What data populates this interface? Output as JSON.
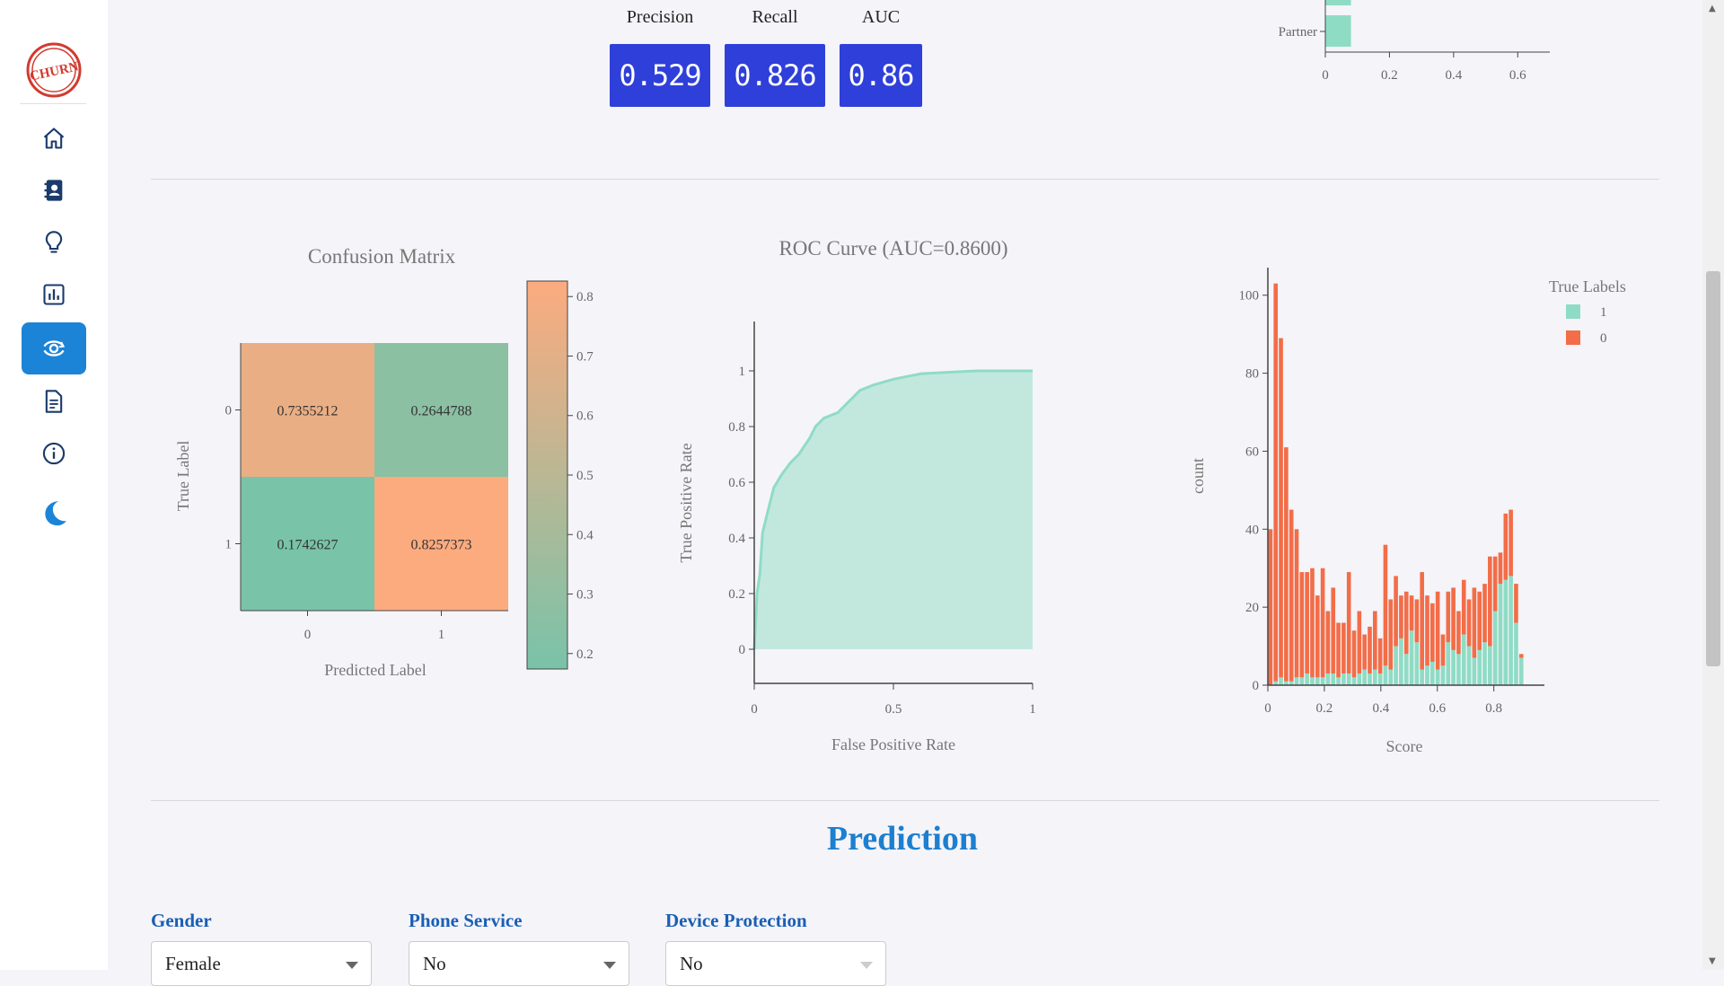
{
  "metrics": [
    {
      "label": "Precision",
      "value": "0.529"
    },
    {
      "label": "Recall",
      "value": "0.826"
    },
    {
      "label": "AUC",
      "value": "0.86"
    }
  ],
  "logo_text": "CHURN",
  "nav": [
    {
      "icon": "home-icon"
    },
    {
      "icon": "contacts-icon"
    },
    {
      "icon": "lightbulb-icon"
    },
    {
      "icon": "bar-chart-icon"
    },
    {
      "icon": "model-icon",
      "active": true
    },
    {
      "icon": "document-icon"
    },
    {
      "icon": "info-icon"
    },
    {
      "icon": "moon-icon"
    }
  ],
  "colors": {
    "accent": "#1c84d7",
    "metric_box": "#2f3fd9",
    "mint": "#8fdcc4",
    "orange": "#f26d48",
    "peach": "#fcab7f",
    "teal": "#79c3a9"
  },
  "chart_data": [
    {
      "type": "bar",
      "orientation": "horizontal",
      "categories": [
        "Partner"
      ],
      "values": [
        0.08
      ],
      "xticks": [
        "0",
        "0.2",
        "0.4",
        "0.6"
      ],
      "xlim": [
        0,
        0.7
      ]
    },
    {
      "type": "heatmap",
      "title": "Confusion Matrix",
      "xlabel": "Predicted Label",
      "ylabel": "True Label",
      "x_categories": [
        "0",
        "1"
      ],
      "y_categories": [
        "0",
        "1"
      ],
      "z": [
        [
          0.7355212,
          0.2644788
        ],
        [
          0.1742627,
          0.8257373
        ]
      ],
      "z_labels": [
        [
          "0.7355212",
          "0.2644788"
        ],
        [
          "0.1742627",
          "0.8257373"
        ]
      ],
      "colorscale": [
        "#79c3a9",
        "#fcab7f"
      ],
      "colorbar_ticks": [
        "0.8",
        "0.7",
        "0.6",
        "0.5",
        "0.4",
        "0.3",
        "0.2"
      ],
      "zlim": [
        0.174,
        0.826
      ]
    },
    {
      "type": "area",
      "title": "ROC Curve (AUC=0.8600)",
      "xlabel": "False Positive Rate",
      "ylabel": "True Positive Rate",
      "xlim": [
        0,
        1
      ],
      "ylim": [
        0,
        1
      ],
      "xticks": [
        "0",
        "0.5",
        "1"
      ],
      "yticks": [
        "0",
        "0.2",
        "0.4",
        "0.6",
        "0.8",
        "1"
      ],
      "x": [
        0,
        0.005,
        0.01,
        0.02,
        0.03,
        0.05,
        0.07,
        0.1,
        0.13,
        0.16,
        0.2,
        0.22,
        0.25,
        0.3,
        0.33,
        0.38,
        0.43,
        0.5,
        0.6,
        0.7,
        0.8,
        1.0
      ],
      "y": [
        0,
        0.1,
        0.2,
        0.27,
        0.42,
        0.5,
        0.58,
        0.63,
        0.67,
        0.7,
        0.76,
        0.8,
        0.83,
        0.85,
        0.88,
        0.93,
        0.95,
        0.97,
        0.99,
        0.995,
        1.0,
        1.0
      ]
    },
    {
      "type": "bar",
      "mode": "stacked",
      "xlabel": "Score",
      "ylabel": "count",
      "xlim": [
        0,
        0.96
      ],
      "ylim": [
        0,
        108
      ],
      "xticks": [
        "0",
        "0.2",
        "0.4",
        "0.6",
        "0.8"
      ],
      "yticks": [
        "0",
        "20",
        "40",
        "60",
        "80",
        "100"
      ],
      "legend_title": "True Labels",
      "legend_position": "top-right",
      "bin_start": 0,
      "bin_width": 0.0185,
      "series": [
        {
          "name": "1",
          "values": [
            0,
            1,
            2,
            1,
            1,
            2,
            2,
            3,
            2,
            2,
            2,
            3,
            3,
            2,
            3,
            3,
            2,
            3,
            4,
            3,
            4,
            3,
            5,
            4,
            10,
            12,
            8,
            14,
            11,
            4,
            5,
            6,
            4,
            5,
            11,
            9,
            8,
            13,
            10,
            7,
            9,
            11,
            10,
            19,
            26,
            27,
            28,
            16,
            7
          ]
        },
        {
          "name": "0",
          "values": [
            40,
            102,
            87,
            60,
            44,
            38,
            27,
            26,
            28,
            21,
            28,
            16,
            22,
            14,
            13,
            26,
            12,
            16,
            9,
            12,
            15,
            9,
            31,
            18,
            18,
            11,
            16,
            9,
            11,
            25,
            18,
            15,
            20,
            8,
            13,
            16,
            11,
            14,
            12,
            18,
            15,
            15,
            23,
            14,
            8,
            17,
            17,
            10,
            1
          ]
        }
      ]
    }
  ],
  "prediction": {
    "title": "Prediction",
    "fields": [
      {
        "label": "Gender",
        "value": "Female"
      },
      {
        "label": "Phone Service",
        "value": "No"
      },
      {
        "label": "Device Protection",
        "value": "No"
      }
    ]
  }
}
